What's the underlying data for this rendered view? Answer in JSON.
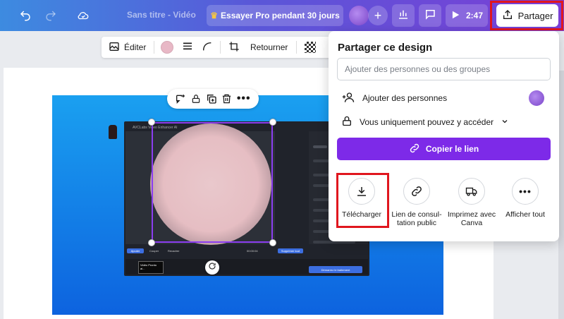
{
  "topbar": {
    "title": "Sans titre - Vidéo",
    "pro_button": "Essayer Pro pendant 30 jours",
    "play_time": "2:47",
    "share_button": "Partager",
    "icons": [
      "undo-icon",
      "redo-icon",
      "cloud-saved-icon",
      "crown-icon",
      "plus-icon",
      "chart-icon",
      "comment-icon",
      "play-icon",
      "share-upload-icon"
    ]
  },
  "context_toolbar": {
    "edit_label": "Éditer",
    "flip_label": "Retourner",
    "swatch_color": "#e8b8c6"
  },
  "object_toolbar": {
    "icons": [
      "add-comment-icon",
      "lock-icon",
      "duplicate-icon",
      "trash-icon",
      "more-icon"
    ]
  },
  "embedded_app": {
    "title": "AVCLabs Video Enhancer AI",
    "import_button": "Ajouter",
    "cut_label": "Couper",
    "resize_label": "Recadrer",
    "time_code": "00:00:04",
    "delete_all_button": "Supprimer tout",
    "start_button": "Démarrez le traitement",
    "thumb_caption": "Vidéo Pronto ai..."
  },
  "share_panel": {
    "title": "Partager ce design",
    "input_placeholder": "Ajouter des personnes ou des groupes",
    "add_people": "Ajouter des personnes",
    "access_label": "Vous uniquement pouvez y accéder",
    "copy_link": "Copier le lien",
    "options": [
      {
        "label": "Télécharger",
        "icon": "download-icon"
      },
      {
        "label": "Lien de consul-tation public",
        "icon": "link-icon"
      },
      {
        "label": "Imprimez avec Canva",
        "icon": "truck-icon"
      },
      {
        "label": "Afficher tout",
        "icon": "more-icon"
      }
    ],
    "accent_color": "#7d2ae8"
  }
}
